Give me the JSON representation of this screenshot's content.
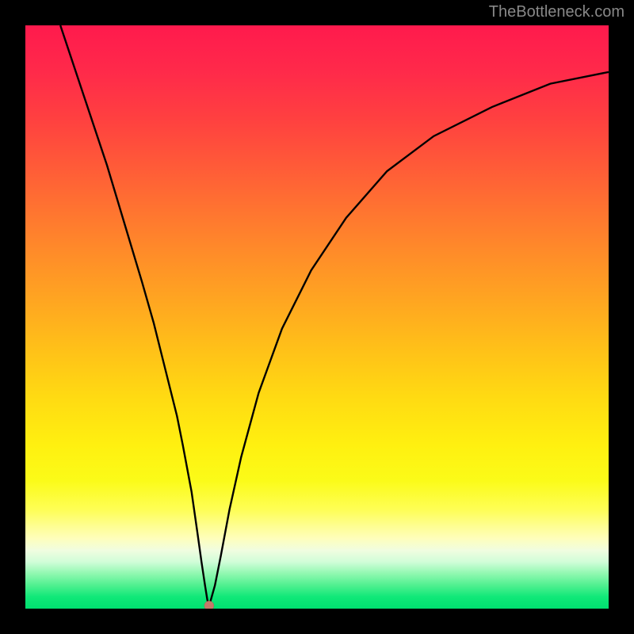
{
  "watermark": "TheBottleneck.com",
  "chart_data": {
    "type": "line",
    "title": "",
    "xlabel": "",
    "ylabel": "",
    "xlim": [
      0,
      100
    ],
    "ylim": [
      0,
      100
    ],
    "curve": {
      "x": [
        6,
        10,
        14,
        17,
        20,
        22,
        24,
        26,
        27,
        28.5,
        29.5,
        30.2,
        30.8,
        31.2,
        31.5,
        31.8,
        32.5,
        33.5,
        35,
        37,
        40,
        44,
        49,
        55,
        62,
        70,
        80,
        90,
        100
      ],
      "values": [
        100,
        88,
        76,
        66,
        56,
        49,
        41,
        33,
        28,
        20,
        13,
        8,
        4,
        1.5,
        0.5,
        1.5,
        4,
        9,
        17,
        26,
        37,
        48,
        58,
        67,
        75,
        81,
        86,
        90,
        92
      ]
    },
    "marker": {
      "x": 31.5,
      "y": 0.5
    },
    "background_gradient": {
      "top": "#ff1a4d",
      "mid": "#ffdb12",
      "bottom": "#00e070"
    }
  }
}
